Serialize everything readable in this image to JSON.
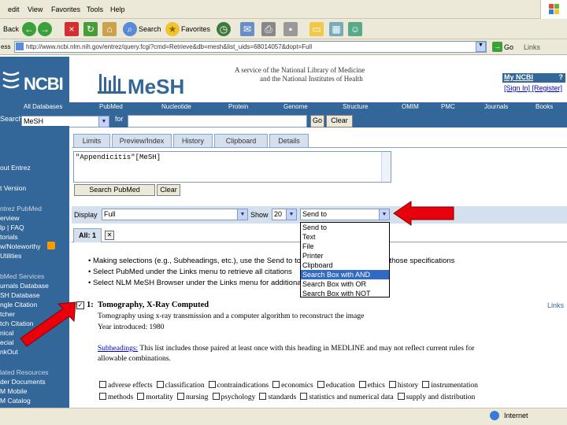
{
  "menu": [
    "edit",
    "View",
    "Favorites",
    "Tools",
    "Help"
  ],
  "toolbar": {
    "back": "Back",
    "search": "Search",
    "favorites": "Favorites"
  },
  "address": {
    "label": "ess",
    "url": "http://www.ncbi.nlm.nih.gov/entrez/query.fcgi?cmd=Retrieve&db=mesh&list_uids=68014057&dopt=Full",
    "go": "Go",
    "links": "Links"
  },
  "header": {
    "ncbi": "NCBI",
    "mesh": "MeSH",
    "tagline1": "A service of the National Library of Medicine",
    "tagline2": "and the National Institutes of Health",
    "myncbi": "My NCBI",
    "help_mark": "?",
    "signin": "[Sign In] [Register]"
  },
  "categories": [
    "All Databases",
    "PubMed",
    "Nucleotide",
    "Protein",
    "Genome",
    "Structure",
    "OMIM",
    "PMC",
    "Journals",
    "Books"
  ],
  "searchbar": {
    "label": "Search",
    "db": "MeSH",
    "for_label": "for",
    "go": "Go",
    "clear": "Clear"
  },
  "tabs": [
    "Limits",
    "Preview/Index",
    "History",
    "Clipboard",
    "Details"
  ],
  "query": "\"Appendicitis\"[MeSH]",
  "query_buttons": {
    "search_pubmed": "Search PubMed",
    "clear": "Clear"
  },
  "display": {
    "label": "Display",
    "value": "Full",
    "show_label": "Show",
    "show_value": "20",
    "sendto_value": "Send to"
  },
  "sendto_options": [
    "Send to",
    "Text",
    "File",
    "Printer",
    "Clipboard",
    "Search Box with AND",
    "Search Box with OR",
    "Search Box with NOT"
  ],
  "sendto_selected": 5,
  "results_tab": "All: 1",
  "bullets": [
    "Making selections (e.g., Subheadings, etc.), use the Send to to see PubMed records with those specifications",
    "Select PubMed under the Links menu to retrieve all citations",
    "Select NLM MeSH Browser under the Links menu for additional"
  ],
  "record": {
    "index": "1:",
    "title": "Tomography, X-Ray Computed",
    "links": "Links",
    "description": "Tomography using x-ray transmission and a computer algorithm to reconstruct the image",
    "year": "Year introduced: 1980",
    "subheadings_link": "Subheadings:",
    "subheadings_text1": " This list includes those paired at least once with this heading in MEDLINE and may not reflect current rules for",
    "subheadings_text2": "allowable combinations."
  },
  "subheadings_row1": [
    "adverse effects",
    "classification",
    "contraindications",
    "economics",
    "education",
    "ethics",
    "history",
    "instrumentation"
  ],
  "subheadings_row2": [
    "methods",
    "mortality",
    "nursing",
    "psychology",
    "standards",
    "statistics and numerical data",
    "supply and distribution"
  ],
  "leftnav": [
    {
      "text": "out Entrez",
      "sec": false
    },
    {
      "text": "t Version",
      "sec": false
    },
    {
      "text": "ntrez PubMed",
      "sec": true
    },
    {
      "text": "erview",
      "sec": false
    },
    {
      "text": "lp | FAQ",
      "sec": false
    },
    {
      "text": "torials",
      "sec": false
    },
    {
      "text": "w/Noteworthy",
      "sec": false
    },
    {
      "text": "Utilities",
      "sec": false
    },
    {
      "text": "bMed Services",
      "sec": true
    },
    {
      "text": "urnals Database",
      "sec": false
    },
    {
      "text": "SH Database",
      "sec": false
    },
    {
      "text": "ngle Citation",
      "sec": false
    },
    {
      "text": "tcher",
      "sec": false
    },
    {
      "text": "tch Citation",
      "sec": false
    },
    {
      "text": "nical",
      "sec": false
    },
    {
      "text": "ecial",
      "sec": false
    },
    {
      "text": "nkOut",
      "sec": false
    },
    {
      "text": "lated Resources",
      "sec": true
    },
    {
      "text": "der Documents",
      "sec": false
    },
    {
      "text": "M Mobile",
      "sec": false
    },
    {
      "text": "M Catalog",
      "sec": false
    }
  ],
  "status": {
    "zone": "Internet"
  },
  "colors": {
    "ncbi_blue": "#336699",
    "tab_fill": "#d5e0ee",
    "highlight": "#316ac5",
    "arrow_red": "#e8000b"
  }
}
